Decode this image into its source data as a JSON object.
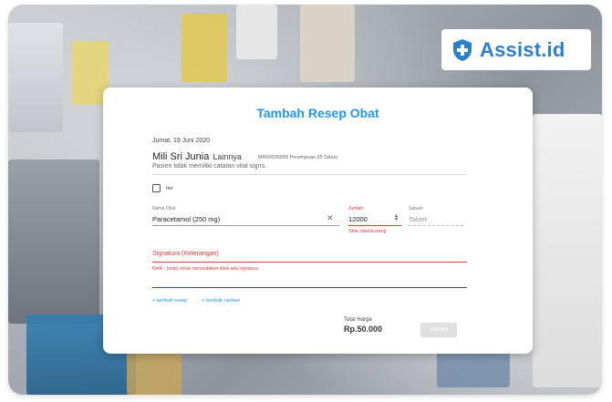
{
  "brand": {
    "logo_text": "Assist.id",
    "accent": "#2196f3"
  },
  "form": {
    "title": "Tambah Resep Obat",
    "date": "Jumat, 19 Juni 2020",
    "patient": {
      "name": "Mili Sri Junia",
      "relation": "Lainnya",
      "meta": "MR00000099   Perempuan   35 Tahun",
      "note": "Pasien tidak memiliki catatan vital signs."
    },
    "iter_label": "Iter",
    "drug": {
      "label": "Nama Obat",
      "value": "Paracetamol (250 mg)"
    },
    "qty": {
      "label": "Jumlah",
      "value": "12000",
      "error": "Stok obat kurang"
    },
    "unit": {
      "label": "Satuan",
      "placeholder": "Tablet"
    },
    "signa": {
      "label": "Signatura (Keterangan)",
      "hint": "Ketik - (strip) untuk menandakan tidak ada signatura"
    },
    "links": {
      "add_recipe": "+ tambah resep",
      "add_compound": "+ tambah racikan"
    },
    "total": {
      "label": "Total Harga",
      "value": "Rp.50.000"
    },
    "save_label": "SIMPAN"
  }
}
